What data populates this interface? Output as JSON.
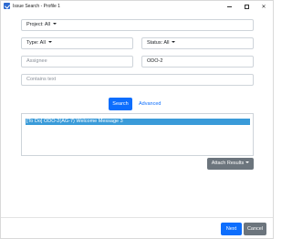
{
  "window": {
    "title": "Issue Search - Profile 1",
    "icon": "check-app-icon",
    "controls": {
      "minimize": "minimize-icon",
      "maximize": "maximize-icon",
      "close": "✕"
    }
  },
  "form": {
    "project": {
      "value": "Project: All"
    },
    "type": {
      "value": "Type: All"
    },
    "status": {
      "value": "Status: All"
    },
    "assignee": {
      "placeholder": "Assignee"
    },
    "issue_key": {
      "value": "ODO-2"
    },
    "contains_text": {
      "placeholder": "Contains text"
    }
  },
  "actions": {
    "search_label": "Search",
    "advanced_label": "Advanced",
    "attach_results_label": "Attach Results"
  },
  "results": [
    {
      "text": "[To Do] ODO-2(AG-7) Welcome Message 3"
    }
  ],
  "footer": {
    "next_label": "Next",
    "cancel_label": "Cancel"
  },
  "colors": {
    "primary": "#0d6efd",
    "secondary": "#6c757d",
    "selection": "#3a9bd9"
  }
}
